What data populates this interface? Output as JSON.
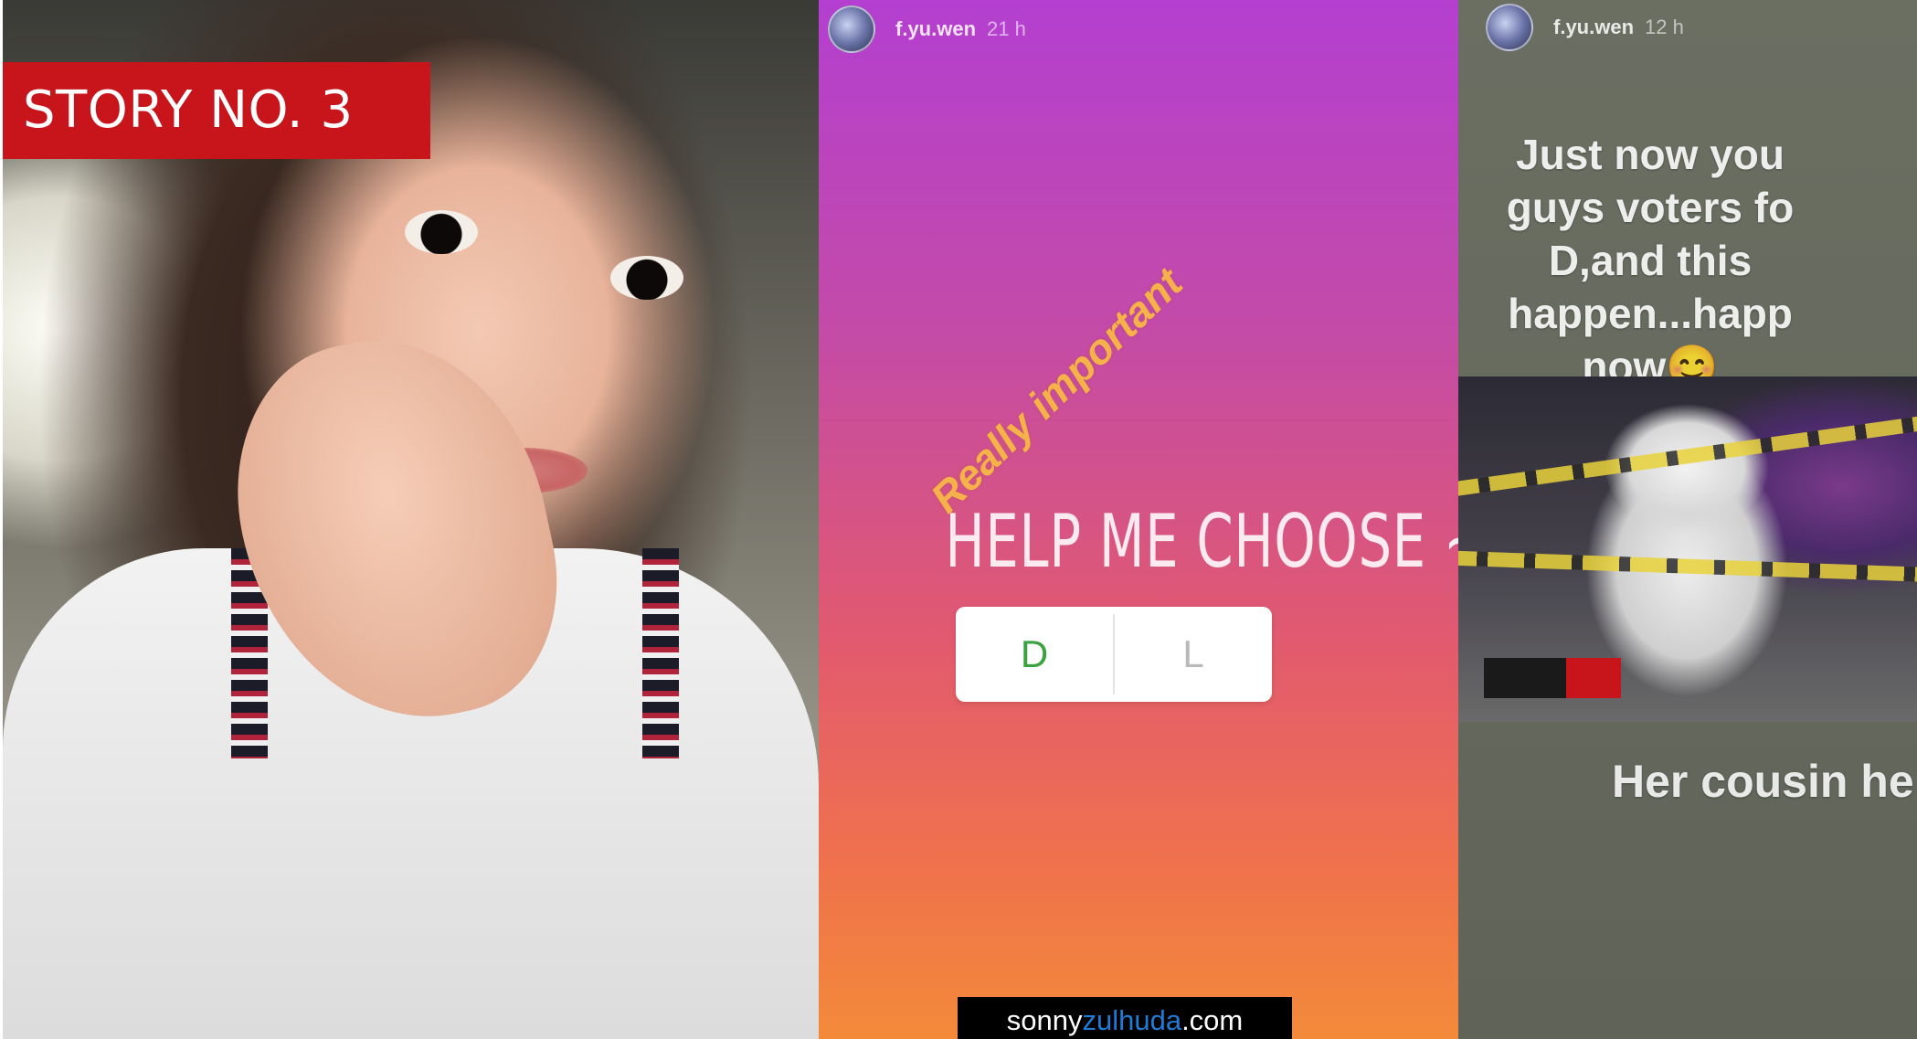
{
  "label": {
    "text": "STORY NO. 3",
    "color": "#c8141b"
  },
  "poll_story": {
    "username": "f.yu.wen",
    "timestamp": "21 h",
    "sticker": "Really important",
    "question": "HELP ME CHOOSE ~",
    "options": [
      {
        "text": "D",
        "color": "#3aa23e"
      },
      {
        "text": "L",
        "color": "#b9b9b9"
      }
    ]
  },
  "news_story": {
    "username": "f.yu.wen",
    "timestamp": "12 h",
    "caption_top": "Just now you\nguys voters fo\nD,and this\nhappen...happ\nnow😊",
    "caption_bottom": "Her cousin he"
  },
  "watermark": {
    "part1": "sonny",
    "part2": "zulhuda",
    "part3": ".com",
    "accent_color": "#1f7bd6"
  }
}
